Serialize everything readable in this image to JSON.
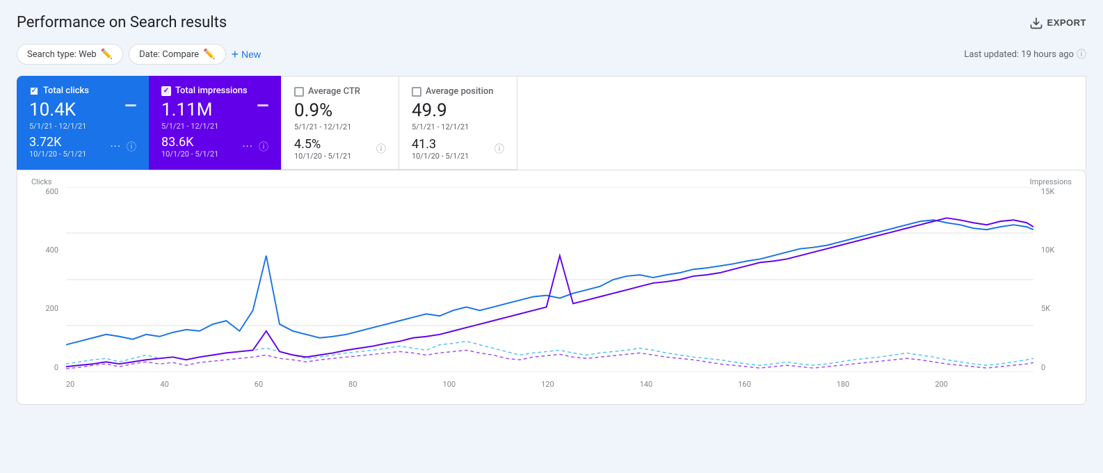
{
  "page": {
    "title": "Performance on Search results"
  },
  "export_button": {
    "label": "EXPORT"
  },
  "filters": {
    "search_type": "Search type: Web",
    "date": "Date: Compare",
    "new_label": "New"
  },
  "last_updated": "Last updated: 19 hours ago",
  "metrics": [
    {
      "id": "total_clicks",
      "label": "Total clicks",
      "active": true,
      "color": "blue",
      "value": "10.4K",
      "date_range": "5/1/21 - 12/1/21",
      "compare_value": "3.72K",
      "compare_date": "10/1/20 - 5/1/21"
    },
    {
      "id": "total_impressions",
      "label": "Total impressions",
      "active": true,
      "color": "purple",
      "value": "1.11M",
      "date_range": "5/1/21 - 12/1/21",
      "compare_value": "83.6K",
      "compare_date": "10/1/20 - 5/1/21"
    },
    {
      "id": "average_ctr",
      "label": "Average CTR",
      "active": false,
      "color": "gray",
      "value": "0.9%",
      "date_range": "5/1/21 - 12/1/21",
      "compare_value": "4.5%",
      "compare_date": "10/1/20 - 5/1/21"
    },
    {
      "id": "average_position",
      "label": "Average position",
      "active": false,
      "color": "gray",
      "value": "49.9",
      "date_range": "5/1/21 - 12/1/21",
      "compare_value": "41.3",
      "compare_date": "10/1/20 - 5/1/21"
    }
  ],
  "chart": {
    "y_left_label": "Clicks",
    "y_right_label": "Impressions",
    "y_left_values": [
      "600",
      "400",
      "200",
      "0"
    ],
    "y_right_values": [
      "15K",
      "10K",
      "5K",
      "0"
    ],
    "x_labels": [
      "20",
      "40",
      "60",
      "80",
      "100",
      "120",
      "140",
      "160",
      "180",
      "200",
      ""
    ]
  }
}
